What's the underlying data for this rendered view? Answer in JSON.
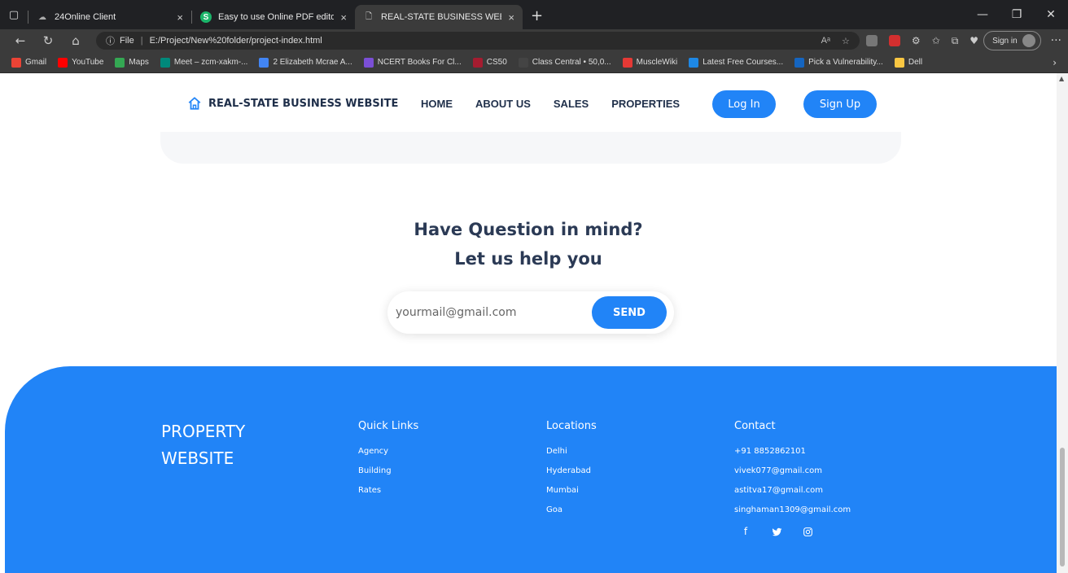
{
  "browser": {
    "tabs": [
      {
        "title": "24Online Client",
        "active": false
      },
      {
        "title": "Easy to use Online PDF editor",
        "active": false
      },
      {
        "title": "REAL-STATE BUSINESS WEBSITE",
        "active": true
      }
    ],
    "url_label": "File",
    "url": "E:/Project/New%20folder/project-index.html",
    "signin_label": "Sign in",
    "bookmarks": [
      {
        "label": "Gmail",
        "color": "#ea4335"
      },
      {
        "label": "YouTube",
        "color": "#ff0000"
      },
      {
        "label": "Maps",
        "color": "#34a853"
      },
      {
        "label": "Meet – zcm-xakm-...",
        "color": "#00897b"
      },
      {
        "label": "2 Elizabeth Mcrae A...",
        "color": "#4285f4"
      },
      {
        "label": "NCERT Books For Cl...",
        "color": "#7b4fd6"
      },
      {
        "label": "CS50",
        "color": "#a51c30"
      },
      {
        "label": "Class Central • 50,0...",
        "color": "#444444"
      },
      {
        "label": "MuscleWiki",
        "color": "#e53935"
      },
      {
        "label": "Latest Free Courses...",
        "color": "#1e88e5"
      },
      {
        "label": "Pick a Vulnerability...",
        "color": "#1565c0"
      },
      {
        "label": "Dell",
        "color": "#f9c642"
      }
    ]
  },
  "header": {
    "brand": "REAL-STATE BUSINESS WEBSITE",
    "nav": [
      "HOME",
      "ABOUT US",
      "SALES",
      "PROPERTIES"
    ],
    "login_label": "Log In",
    "signup_label": "Sign Up"
  },
  "help": {
    "line1": "Have Question in mind?",
    "line2": "Let us help you",
    "email_placeholder": "yourmail@gmail.com",
    "send_label": "SEND"
  },
  "footer": {
    "brand_line1": "PROPERTY",
    "brand_line2": "WEBSITE",
    "quick_links": {
      "heading": "Quick Links",
      "items": [
        "Agency",
        "Building",
        "Rates"
      ]
    },
    "locations": {
      "heading": "Locations",
      "items": [
        "Delhi",
        "Hyderabad",
        "Mumbai",
        "Goa"
      ]
    },
    "contact": {
      "heading": "Contact",
      "items": [
        "+91 8852862101",
        "vivek077@gmail.com",
        "astitva17@gmail.com",
        "singhaman1309@gmail.com"
      ]
    }
  },
  "colors": {
    "accent": "#2184f7",
    "heading": "#2b3a55",
    "brand": "#1f2f4a"
  }
}
